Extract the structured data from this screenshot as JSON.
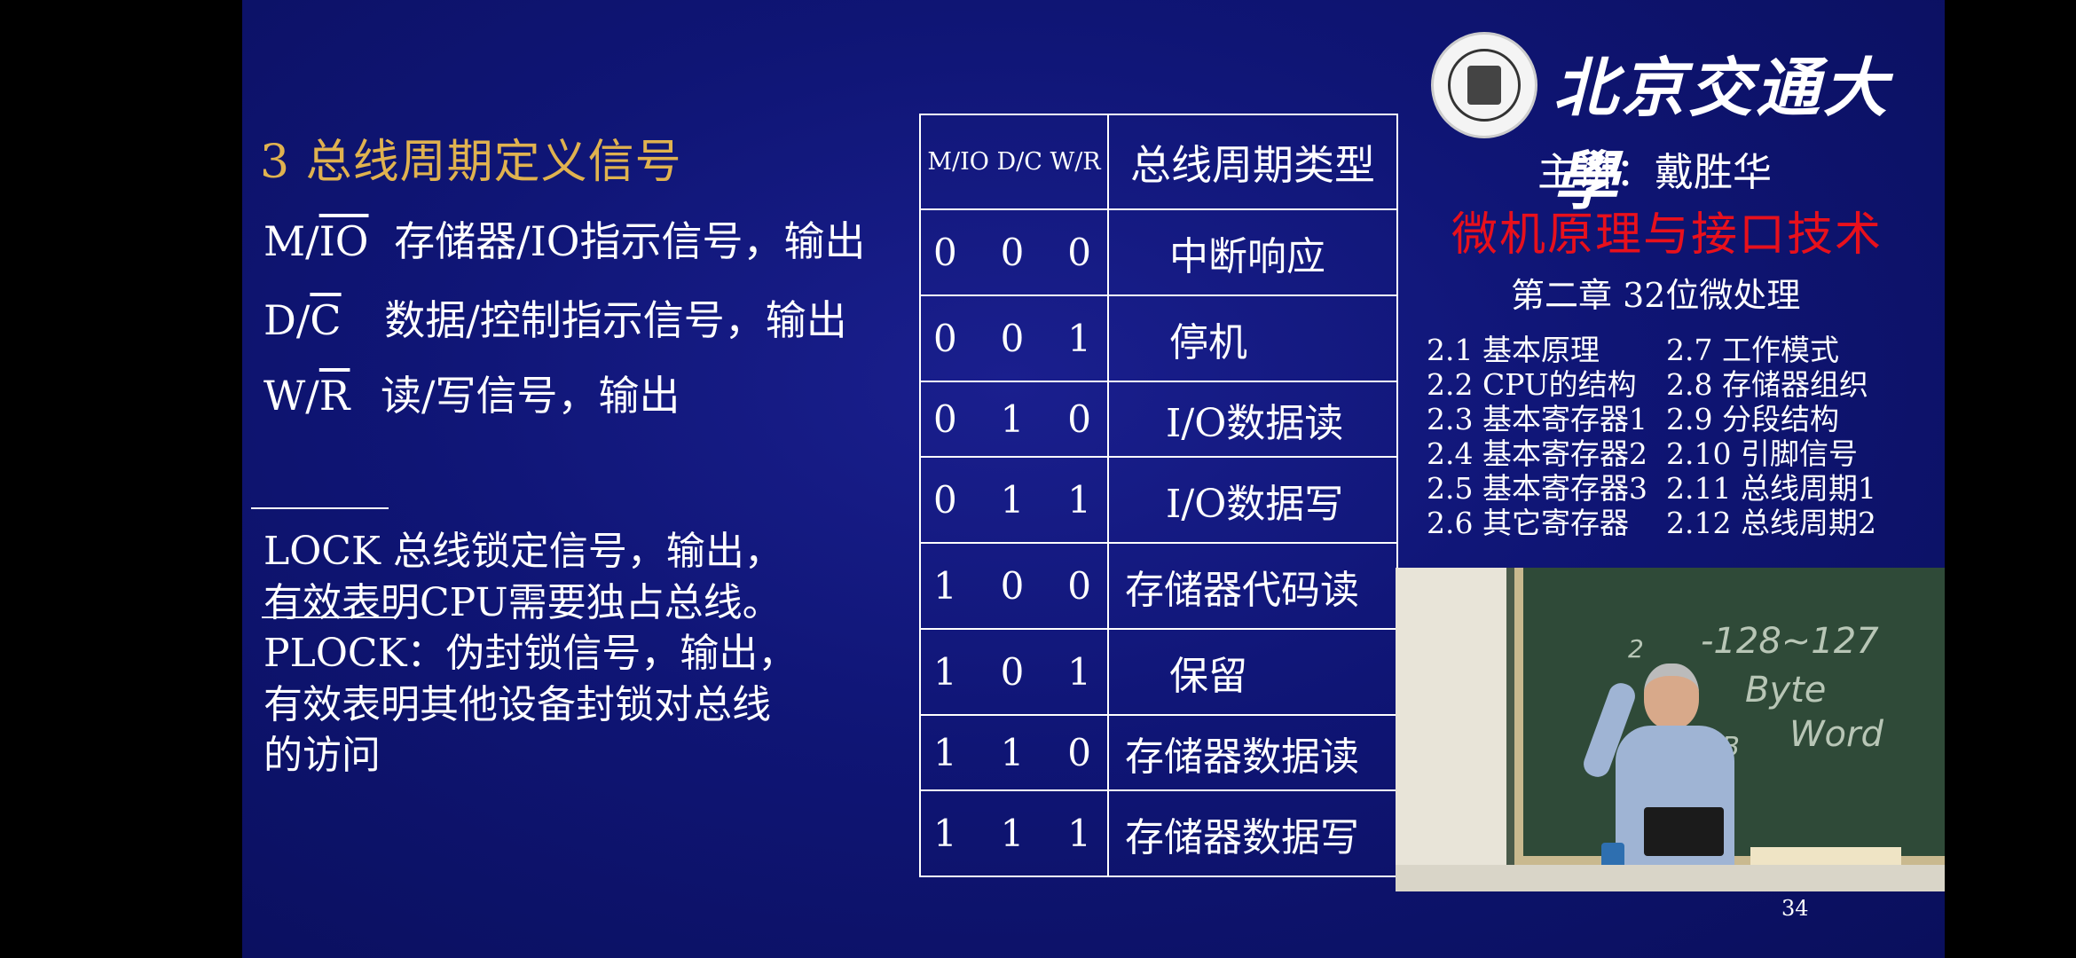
{
  "slide": {
    "section_title": "3 总线周期定义信号",
    "signals": [
      {
        "name": "M/",
        "name_over": "IO",
        "desc": "存储器/IO指示信号，输出"
      },
      {
        "name": "D/",
        "name_over": "C",
        "desc": "数据/控制指示信号，输出"
      },
      {
        "name": "W/",
        "name_over": "R",
        "desc": "读/写信号，输出"
      }
    ],
    "lock_lines": [
      "LOCK 总线锁定信号，输出，",
      "有效表明CPU需要独占总线。",
      "PLOCK：伪封锁信号，输出，",
      "有效表明其他设备封锁对总线",
      "的访问"
    ],
    "table": {
      "header_signals": "M/IO D/C W/R",
      "header_type": "总线周期类型",
      "rows": [
        {
          "bits": [
            "0",
            "0",
            "0"
          ],
          "type": "中断响应"
        },
        {
          "bits": [
            "0",
            "0",
            "1"
          ],
          "type": "停机"
        },
        {
          "bits": [
            "0",
            "1",
            "0"
          ],
          "type": "I/O数据读"
        },
        {
          "bits": [
            "0",
            "1",
            "1"
          ],
          "type": "I/O数据写"
        },
        {
          "bits": [
            "1",
            "0",
            "0"
          ],
          "type": "存储器代码读"
        },
        {
          "bits": [
            "1",
            "0",
            "1"
          ],
          "type": "保留"
        },
        {
          "bits": [
            "1",
            "1",
            "0"
          ],
          "type": "存储器数据读"
        },
        {
          "bits": [
            "1",
            "1",
            "1"
          ],
          "type": "存储器数据写"
        }
      ]
    },
    "university": "北京交通大學",
    "watermark": "C",
    "lecturer": "主讲：戴胜华",
    "course": "微机原理与接口技术",
    "chapter": "第二章 32位微处理",
    "toc_left": [
      "2.1  基本原理",
      "2.2  CPU的结构",
      "2.3  基本寄存器1",
      "2.4  基本寄存器2",
      "2.5  基本寄存器3",
      "2.6  其它寄存器"
    ],
    "toc_right": [
      "2.7  工作模式",
      "2.8  存储器组织",
      "2.9  分段结构",
      "2.10 引脚信号",
      "2.11 总线周期1",
      "2.12 总线周期2"
    ],
    "toc_highlight": "2.10 引脚信号",
    "page_number": "34",
    "chalk": [
      "-128~127",
      "Byte",
      "Word",
      "1TB",
      "2"
    ]
  }
}
